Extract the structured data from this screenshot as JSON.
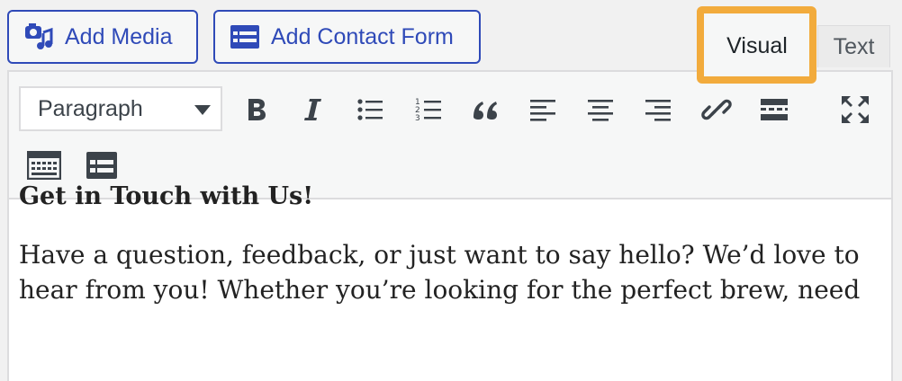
{
  "media_buttons": {
    "add_media": {
      "label": "Add Media",
      "icon": "add-media-icon"
    },
    "add_contact_form": {
      "label": "Add Contact Form",
      "icon": "form-icon"
    }
  },
  "tabs": {
    "visual": {
      "label": "Visual",
      "active": true
    },
    "text": {
      "label": "Text",
      "active": false
    }
  },
  "toolbar": {
    "format_select": {
      "value": "Paragraph"
    },
    "buttons": [
      {
        "icon": "bold-icon"
      },
      {
        "icon": "italic-icon"
      },
      {
        "icon": "bulleted-list-icon"
      },
      {
        "icon": "numbered-list-icon"
      },
      {
        "icon": "blockquote-icon"
      },
      {
        "icon": "align-left-icon"
      },
      {
        "icon": "align-center-icon"
      },
      {
        "icon": "align-right-icon"
      },
      {
        "icon": "link-icon"
      },
      {
        "icon": "read-more-icon"
      },
      {
        "icon": "fullscreen-icon"
      },
      {
        "icon": "toolbar-toggle-icon"
      },
      {
        "icon": "form-block-icon"
      }
    ]
  },
  "content": {
    "heading": "Get in Touch with Us!",
    "body": "Have a question, feedback, or just want to say hello? We’d love to hear from you! Whether you’re looking for the perfect brew, need"
  },
  "colors": {
    "accent_blue": "#2f4ab8",
    "highlight_orange": "#f2ab3c",
    "toolbar_bg": "#f6f7f7",
    "icon_gray": "#3c434a"
  }
}
